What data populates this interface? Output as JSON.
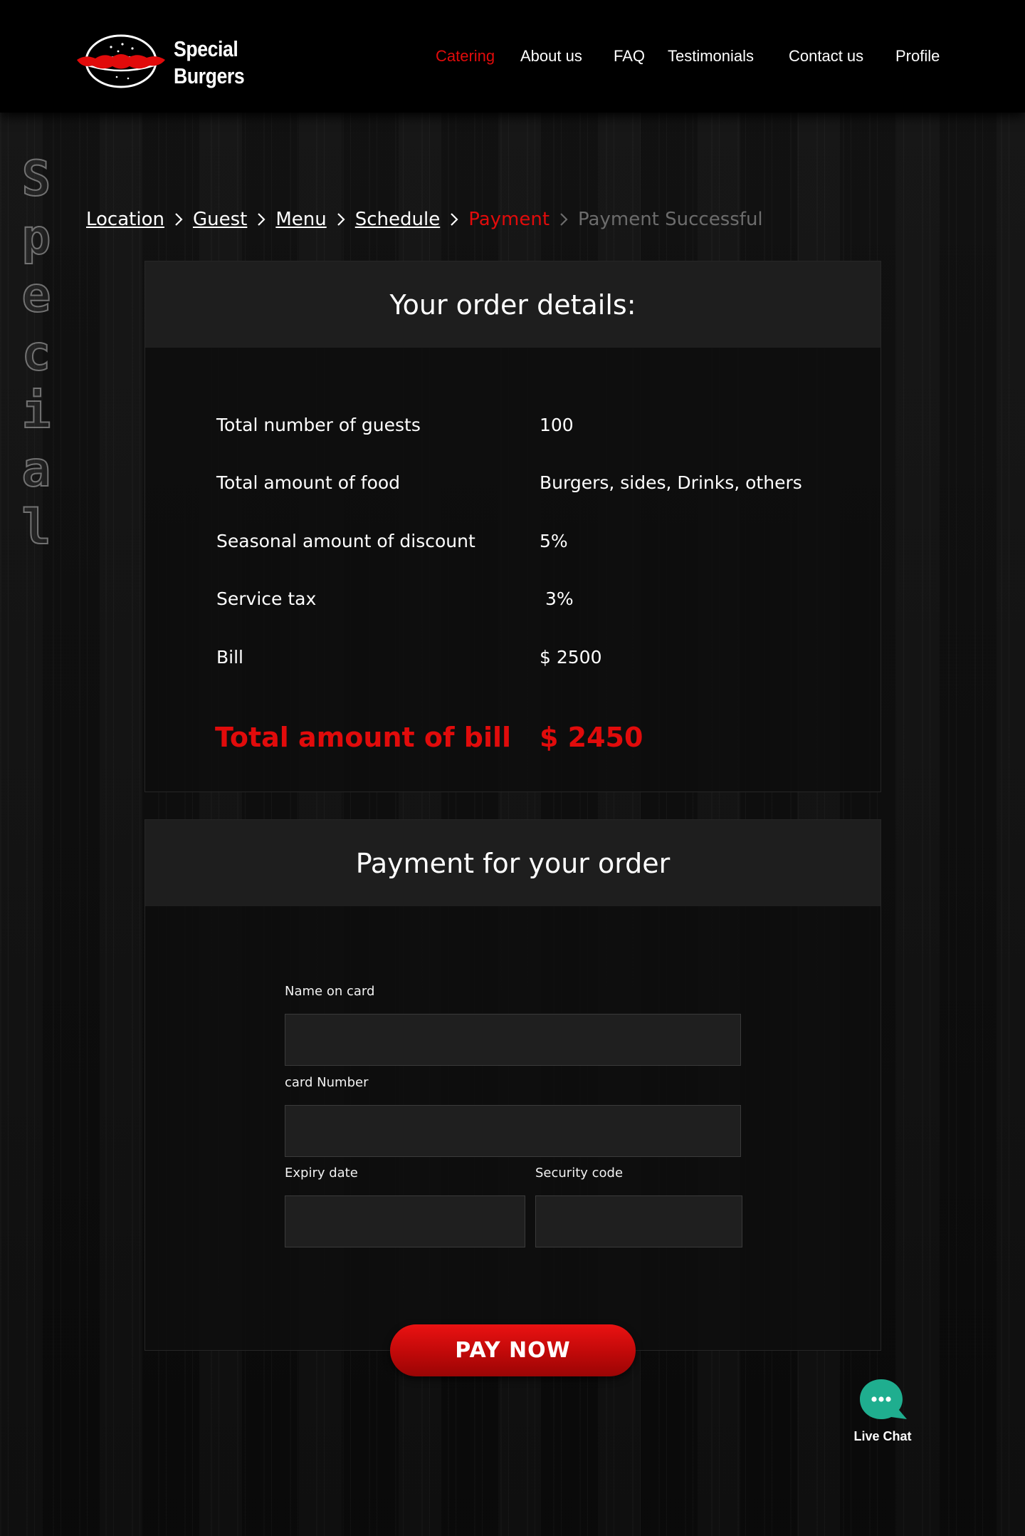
{
  "brand": {
    "name_line1": "Special",
    "name_line2": "Burgers",
    "accent_color": "#e10b0b"
  },
  "nav": {
    "items": [
      {
        "label": "Catering",
        "active": true
      },
      {
        "label": "About us",
        "active": false
      },
      {
        "label": "FAQ",
        "active": false
      },
      {
        "label": "Testimonials",
        "active": false
      },
      {
        "label": "Contact us",
        "active": false
      },
      {
        "label": "Profile",
        "active": false
      }
    ]
  },
  "side_word": [
    "S",
    "p",
    "e",
    "c",
    "i",
    "a",
    "l"
  ],
  "breadcrumb": {
    "steps": [
      {
        "label": "Location",
        "state": "done"
      },
      {
        "label": "Guest",
        "state": "done"
      },
      {
        "label": "Menu",
        "state": "done"
      },
      {
        "label": "Schedule",
        "state": "done"
      },
      {
        "label": "Payment",
        "state": "current"
      },
      {
        "label": "Payment Successful",
        "state": "upcoming"
      }
    ],
    "separator_icon": "chevron-right-icon"
  },
  "order": {
    "title": "Your order details:",
    "rows": [
      {
        "label": "Total number of guests",
        "value": "100"
      },
      {
        "label": "Total amount of food",
        "value": "Burgers, sides, Drinks, others"
      },
      {
        "label": "Seasonal amount of discount",
        "value": "5%"
      },
      {
        "label": "Service tax",
        "value": " 3%"
      },
      {
        "label": "Bill",
        "value": "$ 2500"
      }
    ],
    "total_label": "Total amount of bill",
    "total_value": "$ 2450"
  },
  "payment": {
    "title": "Payment for your order",
    "fields": {
      "name_on_card": {
        "label": "Name on card",
        "value": ""
      },
      "card_number": {
        "label": "card Number",
        "value": ""
      },
      "expiry_date": {
        "label": "Expiry date",
        "value": ""
      },
      "security_code": {
        "label": "Security code",
        "value": ""
      }
    },
    "submit_label": "PAY NOW"
  },
  "live_chat": {
    "label": "Live Chat",
    "icon": "chat-bubble-icon",
    "color": "#1fae8f"
  }
}
